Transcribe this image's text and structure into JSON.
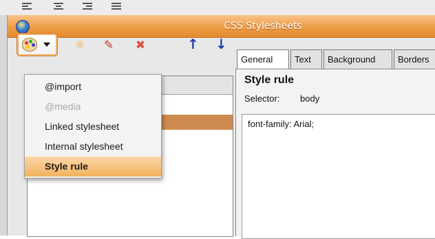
{
  "window": {
    "title": "CSS Stylesheets"
  },
  "toolbar": {
    "icons": [
      "palette-icon",
      "sun-arrow-icon",
      "edit-icon",
      "delete-icon",
      "up-arrow-icon",
      "down-arrow-icon"
    ],
    "up_glyph": "↑",
    "down_glyph": "↓",
    "delete_glyph": "✖",
    "edit_glyph": "✎",
    "sun_glyph": "☼"
  },
  "menu": {
    "items": [
      {
        "label": "@import",
        "state": "normal"
      },
      {
        "label": "@media",
        "state": "disabled"
      },
      {
        "label": "Linked stylesheet",
        "state": "normal"
      },
      {
        "label": "Internal stylesheet",
        "state": "normal"
      },
      {
        "label": "Style rule",
        "state": "selected"
      }
    ]
  },
  "tabs": [
    {
      "label": "General",
      "active": true
    },
    {
      "label": "Text",
      "active": false
    },
    {
      "label": "Background",
      "active": false
    },
    {
      "label": "Borders",
      "active": false
    }
  ],
  "rule": {
    "title": "Style rule",
    "selector_label": "Selector:",
    "selector_value": "body",
    "editor_text": "font-family: Arial;"
  },
  "colors": {
    "titlebar": "#ef9d46",
    "selected_row": "#cf8a4f",
    "menu_selected": "#f2b25c",
    "arrow_blue": "#1e3fa8"
  }
}
